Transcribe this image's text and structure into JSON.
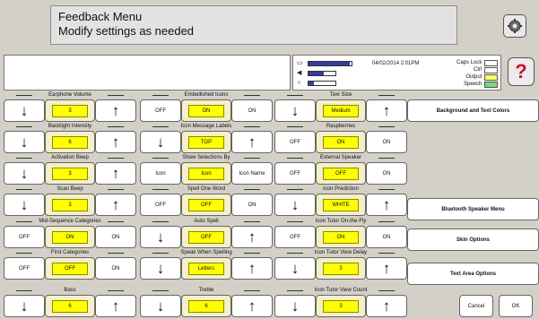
{
  "header": {
    "line1": "Feedback Menu",
    "line2": "Modify settings as needed"
  },
  "status": {
    "date": "04/02/2014 2:01PM",
    "bars": [
      {
        "icon": "battery-icon",
        "glyph": "▭",
        "level": 0.95
      },
      {
        "icon": "speaker-icon",
        "glyph": "◀",
        "level": 0.55
      },
      {
        "icon": "headphones-icon",
        "glyph": "∩",
        "level": 0.2
      }
    ],
    "keys": [
      {
        "label": "Caps Lock",
        "color": "white"
      },
      {
        "label": "Ctrl",
        "color": "white"
      },
      {
        "label": "Output",
        "color": "yellow"
      },
      {
        "label": "Speech",
        "color": "green"
      }
    ]
  },
  "help_label": "?",
  "settings": {
    "earphone_volume": {
      "label": "Earphone Volume",
      "value": "3"
    },
    "embellished_icons": {
      "label": "Embellished Icons",
      "left": "OFF",
      "mid": "ON",
      "right": "ON"
    },
    "text_size": {
      "label": "Text Size",
      "value": "Medium"
    },
    "backlight": {
      "label": "Backlight Intensity",
      "value": "6"
    },
    "icon_msg_labels": {
      "label": "Icon Message Labels",
      "value": "TOP"
    },
    "raspberries": {
      "label": "Raspberries",
      "left": "OFF",
      "mid": "ON",
      "right": "ON"
    },
    "activation_beep": {
      "label": "Activation Beep",
      "value": "3"
    },
    "show_selections": {
      "label": "Show Selections By",
      "left": "Icon",
      "mid": "Icon",
      "right": "Icon Name"
    },
    "external_speaker": {
      "label": "External Speaker",
      "left": "OFF",
      "mid": "OFF",
      "right": "ON"
    },
    "scan_beep": {
      "label": "Scan Beep",
      "value": "3"
    },
    "spell_one_word": {
      "label": "Spell One Word",
      "left": "OFF",
      "mid": "OFF",
      "right": "ON"
    },
    "icon_prediction": {
      "label": "Icon Prediction",
      "value": "WHITE"
    },
    "mid_seq_categories": {
      "label": "Mid-Sequence Categories",
      "left": "OFF",
      "mid": "ON",
      "right": "ON"
    },
    "auto_spell": {
      "label": "Auto Spell",
      "value": "OFF"
    },
    "icon_tutor_otf": {
      "label": "Icon Tutor On-the-Fly",
      "left": "OFF",
      "mid": "ON",
      "right": "ON"
    },
    "first_categories": {
      "label": "First Categories",
      "left": "OFF",
      "mid": "OFF",
      "right": "ON"
    },
    "speak_when_spelling": {
      "label": "Speak When Spelling",
      "value": "Letters"
    },
    "icon_tutor_delay": {
      "label": "Icon Tutor View Delay",
      "value": "3"
    },
    "bass": {
      "label": "Bass",
      "value": "6"
    },
    "treble": {
      "label": "Treble",
      "value": "6"
    },
    "icon_tutor_count": {
      "label": "Icon Tutor View Count",
      "value": "3"
    }
  },
  "buttons": {
    "bg_text_colors": "Background and Text Colors",
    "bluetooth": "Bluetooth Speaker Menu",
    "skin": "Skin Options",
    "text_area": "Text Area Options",
    "cancel": "Cancel",
    "ok": "OK"
  },
  "arrows": {
    "down": "↓",
    "up": "↑"
  }
}
